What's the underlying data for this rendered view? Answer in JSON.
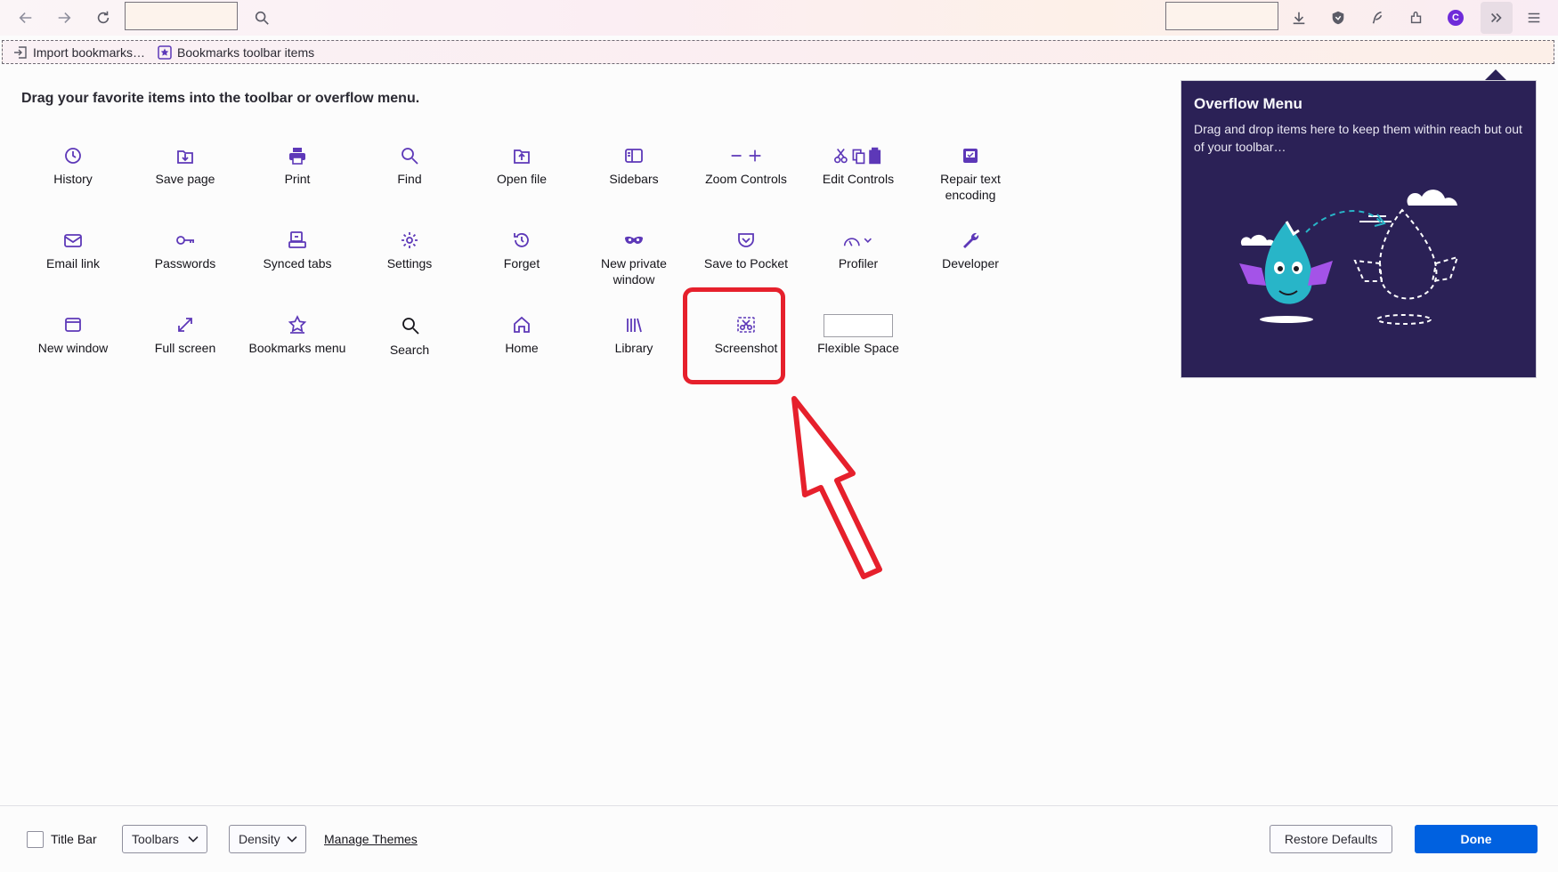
{
  "colors": {
    "accent": "#5d38b8",
    "primary_button": "#0061e0",
    "panel_bg": "#2b2156",
    "highlight": "#e6202c"
  },
  "toolbar": {
    "left_icons": [
      "back-icon",
      "forward-icon",
      "reload-icon",
      "search-icon"
    ],
    "right_icons": [
      "downloads-icon",
      "shield-icon",
      "feather-icon",
      "extensions-icon",
      "account-avatar",
      "overflow-chevron-icon",
      "menu-icon"
    ],
    "avatar_letter": "C"
  },
  "bookmarks": {
    "import": "Import bookmarks…",
    "toolbar_items": "Bookmarks toolbar items"
  },
  "instructions": "Drag your favorite items into the toolbar or overflow menu.",
  "palette": [
    {
      "label": "History",
      "icon": "history-icon"
    },
    {
      "label": "Save page",
      "icon": "save-page-icon"
    },
    {
      "label": "Print",
      "icon": "print-icon"
    },
    {
      "label": "Find",
      "icon": "find-icon"
    },
    {
      "label": "Open file",
      "icon": "open-file-icon"
    },
    {
      "label": "Sidebars",
      "icon": "sidebars-icon"
    },
    {
      "label": "Zoom Controls",
      "icon": "zoom-controls-icon"
    },
    {
      "label": "Edit Controls",
      "icon": "edit-controls-icon"
    },
    {
      "label": "Repair text encoding",
      "icon": "repair-text-encoding-icon"
    },
    {
      "label": "Email link",
      "icon": "email-icon"
    },
    {
      "label": "Passwords",
      "icon": "key-icon"
    },
    {
      "label": "Synced tabs",
      "icon": "synced-tabs-icon"
    },
    {
      "label": "Settings",
      "icon": "gear-icon"
    },
    {
      "label": "Forget",
      "icon": "forget-icon"
    },
    {
      "label": "New private window",
      "icon": "private-mask-icon"
    },
    {
      "label": "Save to Pocket",
      "icon": "pocket-icon"
    },
    {
      "label": "Profiler",
      "icon": "profiler-icon"
    },
    {
      "label": "Developer",
      "icon": "wrench-icon"
    },
    {
      "label": "New window",
      "icon": "new-window-icon"
    },
    {
      "label": "Full screen",
      "icon": "fullscreen-icon"
    },
    {
      "label": "Bookmarks menu",
      "icon": "bookmark-star-icon"
    },
    {
      "label": "Search",
      "icon": "search-icon"
    },
    {
      "label": "Home",
      "icon": "home-icon"
    },
    {
      "label": "Library",
      "icon": "library-icon"
    },
    {
      "label": "Screenshot",
      "icon": "screenshot-icon"
    },
    {
      "label": "Flexible Space",
      "icon": "flexible-space-box"
    }
  ],
  "overflow_panel": {
    "title": "Overflow Menu",
    "description": "Drag and drop items here to keep them within reach but out of your toolbar…"
  },
  "bottom": {
    "title_bar": "Title Bar",
    "toolbars": "Toolbars",
    "density": "Density",
    "manage_themes": "Manage Themes",
    "restore_defaults": "Restore Defaults",
    "done": "Done"
  }
}
